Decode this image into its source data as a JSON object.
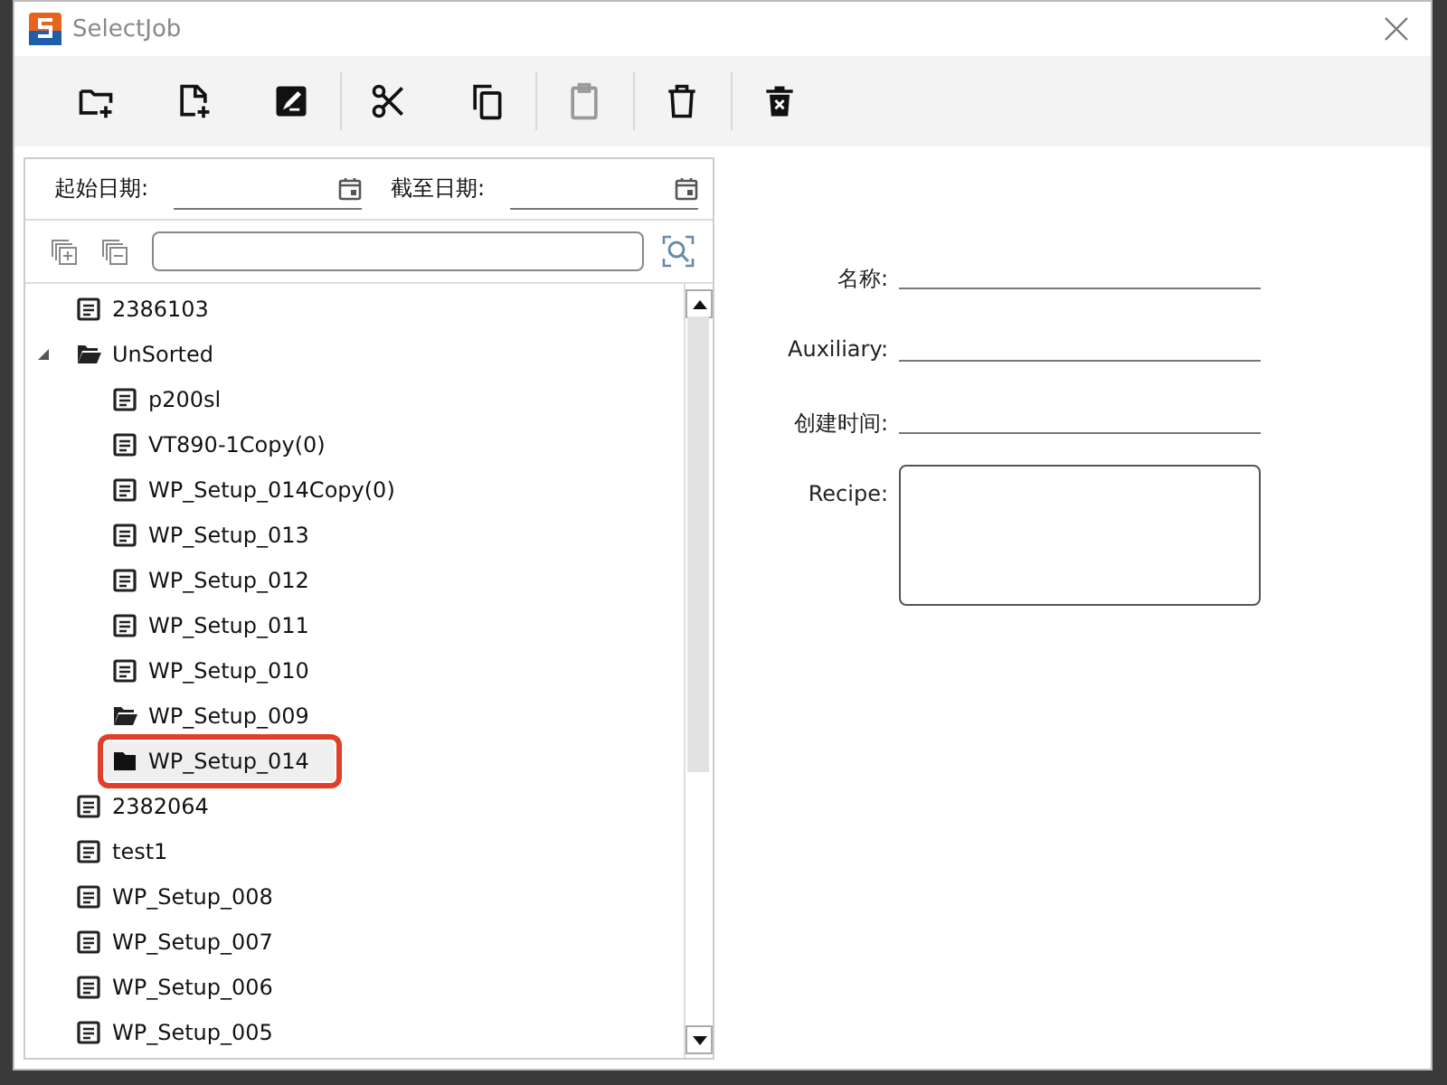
{
  "window": {
    "title": "SelectJob"
  },
  "toolbar": [
    {
      "kind": "new-folder",
      "disabled": false
    },
    {
      "kind": "new-file",
      "disabled": false
    },
    {
      "kind": "edit",
      "disabled": false
    },
    {
      "kind": "separator"
    },
    {
      "kind": "cut",
      "disabled": false
    },
    {
      "kind": "copy",
      "disabled": false
    },
    {
      "kind": "separator"
    },
    {
      "kind": "paste",
      "disabled": true
    },
    {
      "kind": "separator"
    },
    {
      "kind": "delete",
      "disabled": false
    },
    {
      "kind": "separator"
    },
    {
      "kind": "delete-all",
      "disabled": false
    }
  ],
  "date_filter": [
    {
      "label": "起始日期:"
    },
    {
      "label": "截至日期:"
    }
  ],
  "tree": [
    {
      "label": "2386103",
      "kind": "file",
      "selected": false
    },
    {
      "label": "UnSorted",
      "kind": "open-folder",
      "selected": false,
      "expanded": true,
      "children": [
        {
          "label": "p200sl",
          "kind": "file",
          "selected": false
        },
        {
          "label": "VT890-1Copy(0)",
          "kind": "file",
          "selected": false
        },
        {
          "label": "WP_Setup_014Copy(0)",
          "kind": "file",
          "selected": false
        },
        {
          "label": "WP_Setup_013",
          "kind": "file",
          "selected": false
        },
        {
          "label": "WP_Setup_012",
          "kind": "file",
          "selected": false
        },
        {
          "label": "WP_Setup_011",
          "kind": "file",
          "selected": false
        },
        {
          "label": "WP_Setup_010",
          "kind": "file",
          "selected": false
        },
        {
          "label": "WP_Setup_009",
          "kind": "open-folder",
          "selected": false
        },
        {
          "label": "WP_Setup_014",
          "kind": "folder",
          "selected": true,
          "marked": true
        }
      ]
    },
    {
      "label": "2382064",
      "kind": "file",
      "selected": false
    },
    {
      "label": "test1",
      "kind": "file",
      "selected": false
    },
    {
      "label": "WP_Setup_008",
      "kind": "file",
      "selected": false
    },
    {
      "label": "WP_Setup_007",
      "kind": "file",
      "selected": false
    },
    {
      "label": "WP_Setup_006",
      "kind": "file",
      "selected": false
    },
    {
      "label": "WP_Setup_005",
      "kind": "file",
      "selected": false
    }
  ],
  "details": [
    {
      "label": "名称:",
      "kind": "line"
    },
    {
      "label": "Auxiliary:",
      "kind": "line"
    },
    {
      "label": "创建时间:",
      "kind": "line"
    },
    {
      "label": "Recipe:",
      "kind": "area"
    }
  ]
}
